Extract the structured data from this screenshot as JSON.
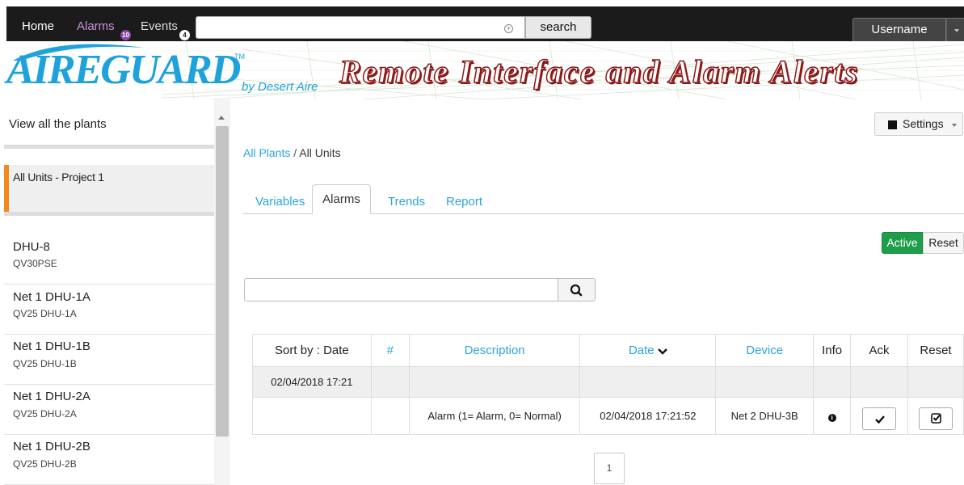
{
  "navbar": {
    "home": "Home",
    "alarms": "Alarms",
    "alarms_count": "10",
    "events": "Events",
    "events_count": "4",
    "search_value": "",
    "search_button": "search",
    "username": "Username"
  },
  "banner": {
    "logo": "AIREGUARD",
    "trademark": "TM",
    "logo_by": "by Desert Aire",
    "title": "Remote Interface and Alarm Alerts"
  },
  "sidebar": {
    "header": "View all the plants",
    "project": "All Units - Project 1",
    "units": [
      {
        "name": "DHU-8",
        "model": "QV30PSE"
      },
      {
        "name": "Net 1 DHU-1A",
        "model": "QV25 DHU-1A"
      },
      {
        "name": "Net 1 DHU-1B",
        "model": "QV25 DHU-1B"
      },
      {
        "name": "Net 1 DHU-2A",
        "model": "QV25 DHU-2A"
      },
      {
        "name": "Net 1 DHU-2B",
        "model": "QV25 DHU-2B"
      }
    ]
  },
  "main": {
    "settings": "Settings",
    "breadcrumb": {
      "root": "All Plants",
      "sep": " / ",
      "current": "All Units"
    },
    "tabs": [
      "Variables",
      "Alarms",
      "Trends",
      "Report"
    ],
    "toggle": {
      "active": "Active",
      "reset": "Reset"
    },
    "filter_value": "",
    "table": {
      "headers": [
        "Sort by : Date",
        "#",
        "Description",
        "Date",
        "Device",
        "Info",
        "Ack",
        "Reset"
      ],
      "group_label": "02/04/2018 17:21",
      "row": {
        "description": "Alarm (1= Alarm, 0= Normal)",
        "date": "02/04/2018 17:21:52",
        "device": "Net 2 DHU-3B"
      }
    },
    "page": "1"
  },
  "colors": {
    "accent": "#2aa4dc",
    "active_green": "#1e9e4a",
    "project_marker": "#f08a1e",
    "alarms_purple": "#c98fd6"
  }
}
